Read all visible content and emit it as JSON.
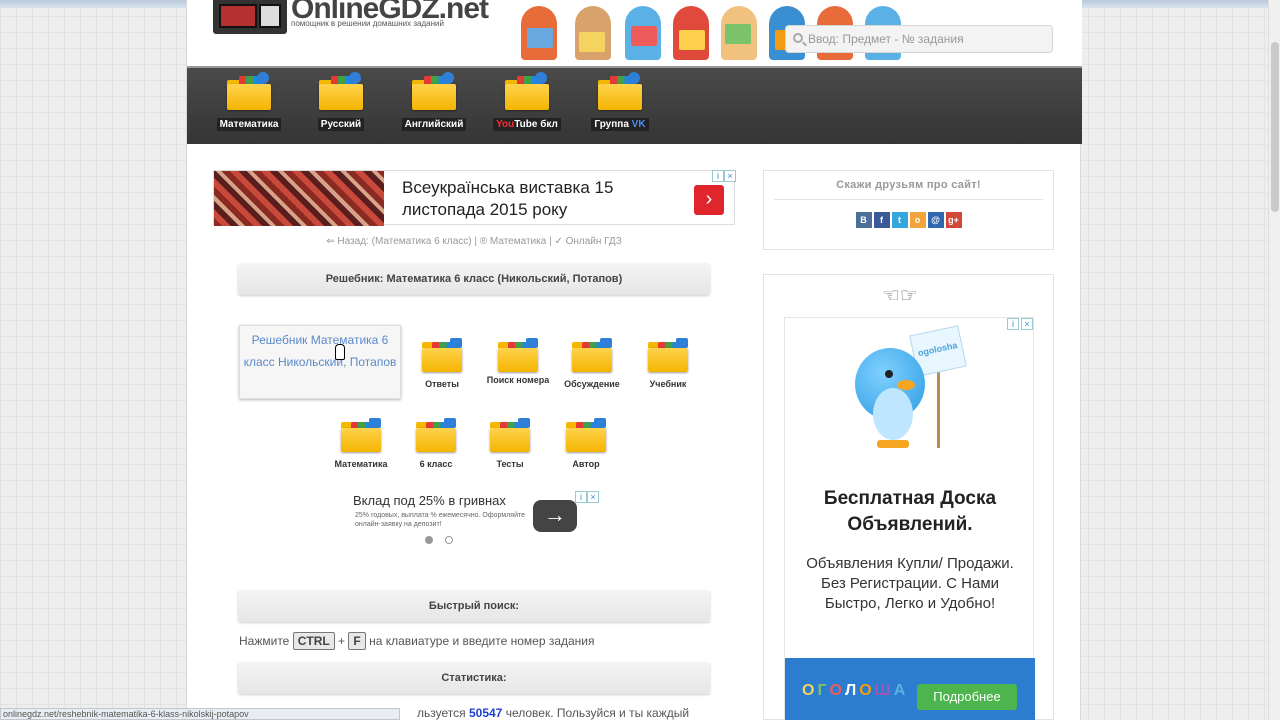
{
  "header": {
    "logo_text": "OnlineGDZ.net",
    "logo_subtitle": "помощник в решении домашних заданий",
    "search_placeholder": "Ввод: Предмет - № задания"
  },
  "nav": [
    {
      "label": "Математика"
    },
    {
      "label": "Русский"
    },
    {
      "label": "Английский"
    },
    {
      "label_a": "You",
      "label_b": "Tube бкл"
    },
    {
      "label_a": "Группа ",
      "label_b": "VK"
    }
  ],
  "ad_banner": {
    "text": "Всеукраїнська виставка 15 листопада 2015 року",
    "arrow": "›"
  },
  "breadcrumb": "⇐ Назад: (Математика 6 класс) | ® Математика | ✓ Онлайн ГДЗ",
  "title_bar": "Решебник: Математика 6 класс (Никольский, Потапов)",
  "cover_alt": "Решебник Математика 6 класс Никольский, Потапов",
  "sections_row1": [
    {
      "label": "Ответы"
    },
    {
      "label": "Поиск номера"
    },
    {
      "label": "Обсуждение"
    },
    {
      "label": "Учебник"
    }
  ],
  "sections_row2": [
    {
      "label": "Математика"
    },
    {
      "label": "6 класс"
    },
    {
      "label": "Тесты"
    },
    {
      "label": "Автор"
    }
  ],
  "ad2": {
    "title": "Вклад под 25% в гривнах",
    "small": "25% годовых, выплата % ежемесячно. Оформляйте онлайн-заявку на депозит!",
    "arrow": "→"
  },
  "quick_search": {
    "title": "Быстрый поиск:",
    "hint_before": "Нажмите",
    "key1": "CTRL",
    "plus": "+",
    "key2": "F",
    "hint_after": "на клавиатуре и введите номер задания"
  },
  "stats": {
    "title": "Статистика:",
    "line_before": "льзуется",
    "count": "50547",
    "line_after": "человек. Пользуйся и ты каждый"
  },
  "share": {
    "title": "Скажи друзьям про сайт!",
    "icons": [
      {
        "name": "vk",
        "glyph": "В",
        "color": "#4c6f99"
      },
      {
        "name": "facebook",
        "glyph": "f",
        "color": "#3b5998"
      },
      {
        "name": "twitter",
        "glyph": "t",
        "color": "#35a6de"
      },
      {
        "name": "odnoklassniki",
        "glyph": "о",
        "color": "#f4a23a"
      },
      {
        "name": "mailru",
        "glyph": "@",
        "color": "#2f67b1"
      },
      {
        "name": "googleplus",
        "glyph": "g+",
        "color": "#d34836"
      }
    ]
  },
  "side_ad": {
    "hands": "☜☞",
    "sign": "ogolosha",
    "heading": "Бесплатная Доска Объявлений.",
    "text": "Объявления Купли/ Продажи. Без Регистрации. С Нами Быстро, Легко и Удобно!",
    "logo_letters": [
      "О",
      "Г",
      "О",
      "Л",
      "О",
      "Ш",
      "А"
    ],
    "button": "Подробнее"
  },
  "status_url": "onlinegdz.net/reshebnik-matematika-6-klass-nikolskij-potapov"
}
